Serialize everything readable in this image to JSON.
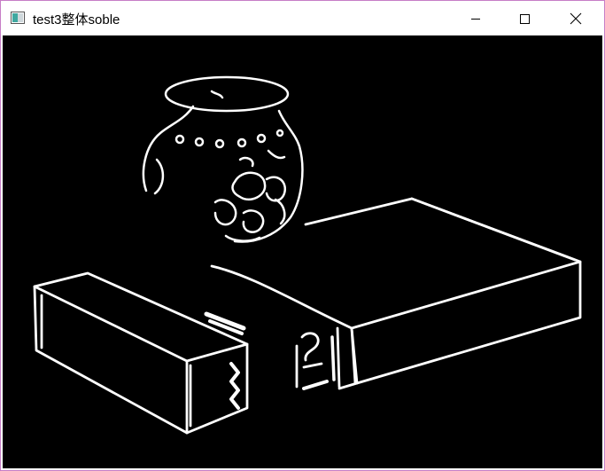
{
  "window": {
    "title": "test3整体soble",
    "controls": {
      "minimize_icon": "minimize-icon",
      "maximize_icon": "maximize-icon",
      "close_icon": "close-icon"
    }
  },
  "canvas": {
    "background": "#000000",
    "edge_color": "#ffffff"
  },
  "colors": {
    "window_border": "#c77dc7"
  }
}
